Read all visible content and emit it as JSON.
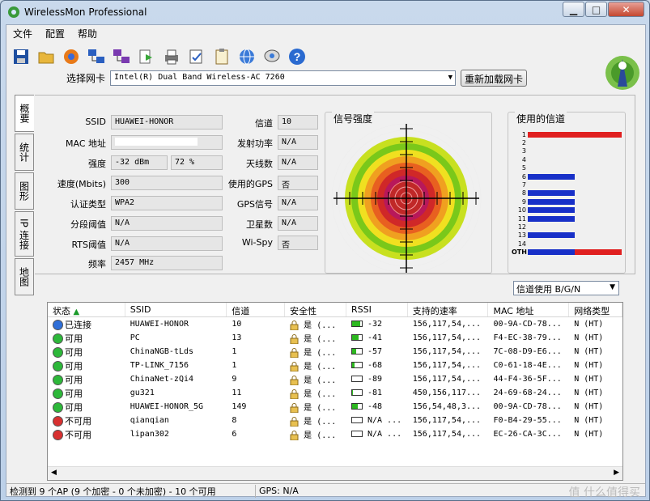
{
  "window": {
    "title": "WirelessMon Professional",
    "min": "▁",
    "max": "□",
    "close": "✕"
  },
  "menu": [
    "文件",
    "配置",
    "帮助"
  ],
  "adapter": {
    "label": "选择网卡",
    "value": "Intel(R) Dual Band Wireless-AC 7260",
    "reload": "重新加载网卡"
  },
  "tabs": [
    "概要",
    "统计",
    "图形",
    "IP 连接",
    "地图"
  ],
  "summary": {
    "ssid_label": "SSID",
    "ssid": "HUAWEI-HONOR",
    "mac_label": "MAC 地址",
    "mac": "",
    "strength_label": "强度",
    "strength_dbm": "-32 dBm",
    "strength_pct": "72 %",
    "speed_label": "速度(Mbits)",
    "speed": "300",
    "auth_label": "认证类型",
    "auth": "WPA2",
    "frag_label": "分段阈值",
    "frag": "N/A",
    "rts_label": "RTS阈值",
    "rts": "N/A",
    "freq_label": "频率",
    "freq": "2457 MHz",
    "channel_label": "信道",
    "channel": "10",
    "txpower_label": "发射功率",
    "txpower": "N/A",
    "antenna_label": "天线数",
    "antenna": "N/A",
    "gps_label": "使用的GPS",
    "gps": "否",
    "gpssig_label": "GPS信号",
    "gpssig": "N/A",
    "sat_label": "卫星数",
    "sat": "N/A",
    "wifispy_label": "Wi-Spy",
    "wifispy": "否"
  },
  "signal": {
    "title": "信号强度"
  },
  "channels": {
    "title": "使用的信道",
    "labels": [
      "1",
      "2",
      "3",
      "4",
      "5",
      "6",
      "7",
      "8",
      "9",
      "10",
      "11",
      "12",
      "13",
      "14",
      "OTH"
    ],
    "usage": [
      {
        "w": 1.0,
        "c": "#e02020"
      },
      {
        "w": 0,
        "c": ""
      },
      {
        "w": 0,
        "c": ""
      },
      {
        "w": 0,
        "c": ""
      },
      {
        "w": 0,
        "c": ""
      },
      {
        "w": 0.5,
        "c": "#1830c8"
      },
      {
        "w": 0,
        "c": ""
      },
      {
        "w": 0.5,
        "c": "#1830c8"
      },
      {
        "w": 0.5,
        "c": "#1830c8"
      },
      {
        "w": 0.5,
        "c": "#1830c8"
      },
      {
        "w": 0.5,
        "c": "#1830c8"
      },
      {
        "w": 0,
        "c": ""
      },
      {
        "w": 0.5,
        "c": "#1830c8"
      },
      {
        "w": 0,
        "c": ""
      },
      {
        "w": 1.0,
        "c": "#mixed"
      }
    ],
    "mode": "信道使用 B/G/N"
  },
  "table": {
    "headers": [
      "状态",
      "SSID",
      "信道",
      "安全性",
      "RSSI",
      "支持的速率",
      "MAC 地址",
      "网络类型"
    ],
    "rows": [
      {
        "status": "已连接",
        "color": "#2f6fd8",
        "ssid": "HUAWEI-HONOR",
        "ch": "10",
        "sec": "是 (...",
        "rssi": "-32",
        "lvl": 0.8,
        "rate": "156,117,54,...",
        "mac": "00-9A-CD-78...",
        "net": "N (HT)"
      },
      {
        "status": "可用",
        "color": "#2db83a",
        "ssid": "PC",
        "ch": "13",
        "sec": "是 (...",
        "rssi": "-41",
        "lvl": 0.65,
        "rate": "156,117,54,...",
        "mac": "F4-EC-38-79...",
        "net": "N (HT)"
      },
      {
        "status": "可用",
        "color": "#2db83a",
        "ssid": "ChinaNGB-tLds",
        "ch": "1",
        "sec": "是 (...",
        "rssi": "-57",
        "lvl": 0.4,
        "rate": "156,117,54,...",
        "mac": "7C-08-D9-E6...",
        "net": "N (HT)"
      },
      {
        "status": "可用",
        "color": "#2db83a",
        "ssid": "TP-LINK_7156",
        "ch": "1",
        "sec": "是 (...",
        "rssi": "-68",
        "lvl": 0.25,
        "rate": "156,117,54,...",
        "mac": "C0-61-18-4E...",
        "net": "N (HT)"
      },
      {
        "status": "可用",
        "color": "#2db83a",
        "ssid": "ChinaNet-zQi4",
        "ch": "9",
        "sec": "是 (...",
        "rssi": "-89",
        "lvl": 0,
        "rate": "156,117,54,...",
        "mac": "44-F4-36-5F...",
        "net": "N (HT)"
      },
      {
        "status": "可用",
        "color": "#2db83a",
        "ssid": "gu321",
        "ch": "11",
        "sec": "是 (...",
        "rssi": "-81",
        "lvl": 0.05,
        "rate": "450,156,117...",
        "mac": "24-69-68-24...",
        "net": "N (HT)"
      },
      {
        "status": "可用",
        "color": "#2db83a",
        "ssid": "HUAWEI-HONOR_5G",
        "ch": "149",
        "sec": "是 (...",
        "rssi": "-48",
        "lvl": 0.55,
        "rate": "156,54,48,3...",
        "mac": "00-9A-CD-78...",
        "net": "N (HT)"
      },
      {
        "status": "不可用",
        "color": "#d83030",
        "ssid": "qianqian",
        "ch": "8",
        "sec": "是 (...",
        "rssi": "N/A ...",
        "lvl": 0,
        "rate": "156,117,54,...",
        "mac": "F0-B4-29-55...",
        "net": "N (HT)"
      },
      {
        "status": "不可用",
        "color": "#d83030",
        "ssid": "lipan302",
        "ch": "6",
        "sec": "是 (...",
        "rssi": "N/A ...",
        "lvl": 0,
        "rate": "156,117,54,...",
        "mac": "EC-26-CA-3C...",
        "net": "N (HT)"
      }
    ]
  },
  "status": {
    "left": "检测到 9 个AP (9 个加密 - 0 个未加密) - 10 个可用",
    "right": "GPS: N/A"
  },
  "watermark": "值 什么值得买"
}
